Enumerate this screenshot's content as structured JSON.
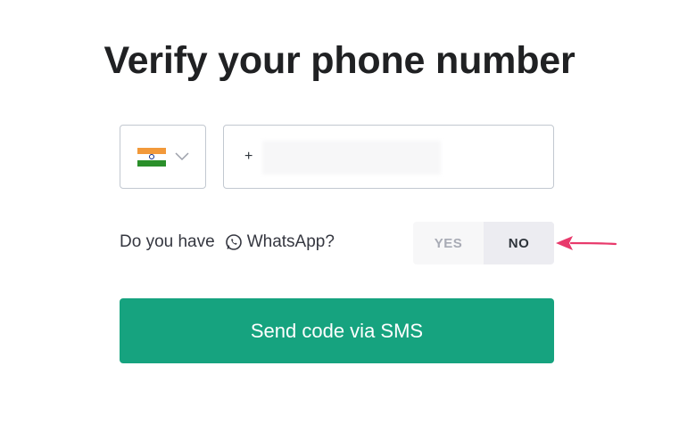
{
  "page": {
    "title": "Verify your phone number"
  },
  "country_selector": {
    "flag_icon": "india-flag-icon",
    "flag_colors": {
      "saffron": "#f2993a",
      "white": "#ffffff",
      "green": "#2a8f2a",
      "chakra": "#0a2a8a"
    },
    "dropdown_icon": "chevron-down-icon"
  },
  "phone_field": {
    "value": "+"
  },
  "whatsapp": {
    "question_prefix": "Do you have",
    "icon": "whatsapp-icon",
    "question_suffix": "WhatsApp?",
    "options": {
      "yes_label": "YES",
      "no_label": "NO"
    },
    "selected": "NO"
  },
  "annotation": {
    "arrow_icon": "arrow-pointer-icon",
    "color": "#e8396b"
  },
  "actions": {
    "send_label": "Send code via SMS",
    "send_color": "#16a37f"
  }
}
